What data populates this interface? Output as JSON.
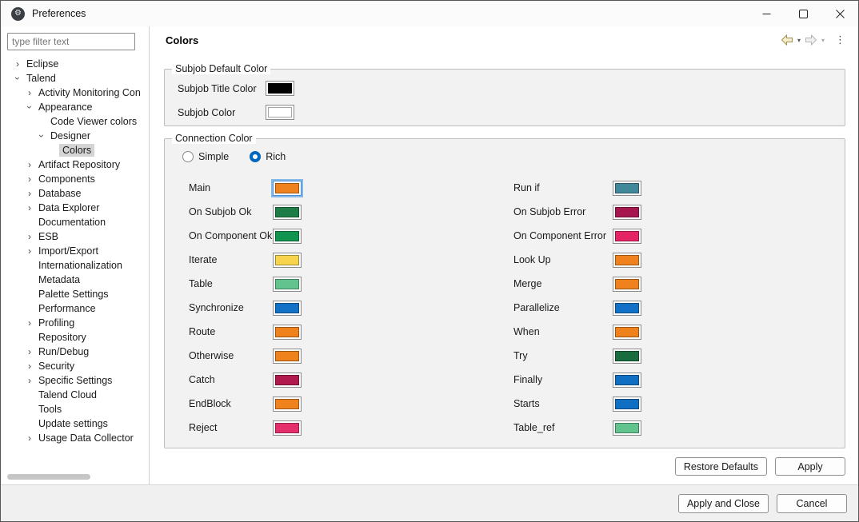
{
  "window": {
    "title": "Preferences"
  },
  "icons": {
    "dropdown": "▾",
    "overflow": "⋮",
    "app_glyph": "⚙"
  },
  "sidebar": {
    "filter_placeholder": "type filter text",
    "tree": [
      {
        "label": "Eclipse",
        "level": 0,
        "state": "collapsed"
      },
      {
        "label": "Talend",
        "level": 0,
        "state": "expanded"
      },
      {
        "label": "Activity Monitoring Con",
        "level": 1,
        "state": "collapsed"
      },
      {
        "label": "Appearance",
        "level": 1,
        "state": "expanded"
      },
      {
        "label": "Code Viewer colors",
        "level": 2,
        "state": "leaf"
      },
      {
        "label": "Designer",
        "level": 2,
        "state": "expanded"
      },
      {
        "label": "Colors",
        "level": 3,
        "state": "leaf",
        "selected": true
      },
      {
        "label": "Artifact Repository",
        "level": 1,
        "state": "collapsed"
      },
      {
        "label": "Components",
        "level": 1,
        "state": "collapsed"
      },
      {
        "label": "Database",
        "level": 1,
        "state": "collapsed"
      },
      {
        "label": "Data Explorer",
        "level": 1,
        "state": "collapsed"
      },
      {
        "label": "Documentation",
        "level": 1,
        "state": "leaf"
      },
      {
        "label": "ESB",
        "level": 1,
        "state": "collapsed"
      },
      {
        "label": "Import/Export",
        "level": 1,
        "state": "collapsed"
      },
      {
        "label": "Internationalization",
        "level": 1,
        "state": "leaf"
      },
      {
        "label": "Metadata",
        "level": 1,
        "state": "leaf"
      },
      {
        "label": "Palette Settings",
        "level": 1,
        "state": "leaf"
      },
      {
        "label": "Performance",
        "level": 1,
        "state": "leaf"
      },
      {
        "label": "Profiling",
        "level": 1,
        "state": "collapsed"
      },
      {
        "label": "Repository",
        "level": 1,
        "state": "leaf"
      },
      {
        "label": "Run/Debug",
        "level": 1,
        "state": "collapsed"
      },
      {
        "label": "Security",
        "level": 1,
        "state": "collapsed"
      },
      {
        "label": "Specific Settings",
        "level": 1,
        "state": "collapsed"
      },
      {
        "label": "Talend Cloud",
        "level": 1,
        "state": "leaf"
      },
      {
        "label": "Tools",
        "level": 1,
        "state": "leaf"
      },
      {
        "label": "Update settings",
        "level": 1,
        "state": "leaf"
      },
      {
        "label": "Usage Data Collector",
        "level": 1,
        "state": "collapsed"
      }
    ]
  },
  "main": {
    "title": "Colors",
    "subjob_group": {
      "title": "Subjob Default Color",
      "rows": [
        {
          "label": "Subjob Title Color",
          "color": "#000000"
        },
        {
          "label": "Subjob Color",
          "color": "#FFFFFF"
        }
      ]
    },
    "connection_group": {
      "title": "Connection Color",
      "radios": [
        {
          "label": "Simple",
          "selected": false
        },
        {
          "label": "Rich",
          "selected": true
        }
      ],
      "left_rows": [
        {
          "label": "Main",
          "color": "#F0821E",
          "focused": true
        },
        {
          "label": "On Subjob Ok",
          "color": "#1E7D46"
        },
        {
          "label": "On Component Ok",
          "color": "#12934F"
        },
        {
          "label": "Iterate",
          "color": "#F8D44C"
        },
        {
          "label": "Table",
          "color": "#62C38E"
        },
        {
          "label": "Synchronize",
          "color": "#1271C6"
        },
        {
          "label": "Route",
          "color": "#F0821E"
        },
        {
          "label": "Otherwise",
          "color": "#F0821E"
        },
        {
          "label": "Catch",
          "color": "#B01A4E"
        },
        {
          "label": "EndBlock",
          "color": "#F0821E"
        },
        {
          "label": "Reject",
          "color": "#E52F6D"
        }
      ],
      "right_rows": [
        {
          "label": "Run if",
          "color": "#42889B"
        },
        {
          "label": "On Subjob Error",
          "color": "#A5164F"
        },
        {
          "label": "On Component Error",
          "color": "#E42465"
        },
        {
          "label": "Look Up",
          "color": "#F0821E"
        },
        {
          "label": "Merge",
          "color": "#F0821E"
        },
        {
          "label": "Parallelize",
          "color": "#1271C6"
        },
        {
          "label": "When",
          "color": "#F0821E"
        },
        {
          "label": "Try",
          "color": "#186C3D"
        },
        {
          "label": "Finally",
          "color": "#0F6FC2"
        },
        {
          "label": "Starts",
          "color": "#0F6FC2"
        },
        {
          "label": "Table_ref",
          "color": "#62C38E"
        }
      ]
    },
    "buttons": {
      "restore_defaults": "Restore Defaults",
      "apply": "Apply"
    }
  },
  "footer": {
    "apply_and_close": "Apply and Close",
    "cancel": "Cancel"
  }
}
